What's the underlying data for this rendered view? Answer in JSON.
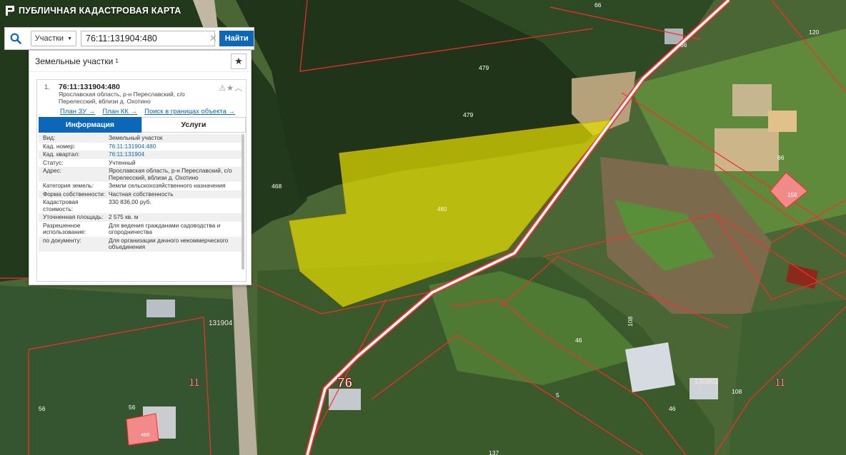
{
  "app": {
    "title": "ПУБЛИЧНАЯ КАДАСТРОВАЯ КАРТА"
  },
  "search": {
    "type_label": "Участки",
    "query": "76:11:131904:480",
    "find_label": "Найти"
  },
  "panel": {
    "title": "Земельные участки",
    "count": "1"
  },
  "result": {
    "number": "1.",
    "cad_number": "76:11:131904:480",
    "address": "Ярославская область, р-н Переславский, с/о Перелесский, вблизи д. Охотино",
    "links": [
      "План ЗУ →",
      "План КК →",
      "Поиск в границах объекта →"
    ]
  },
  "tabs": [
    "Информация",
    "Услуги"
  ],
  "attributes": [
    {
      "label": "Вид:",
      "value": "Земельный участок"
    },
    {
      "label": "Кад. номер:",
      "value": "76:11:131904:480"
    },
    {
      "label": "Кад. квартал:",
      "value": "76:11:131904"
    },
    {
      "label": "Статус:",
      "value": "Учтенный"
    },
    {
      "label": "Адрес:",
      "value": "Ярославская область, р-н Переславский, с/о Перелесский, вблизи д. Охотино"
    },
    {
      "label": "Категория земель:",
      "value": "Земли сельскохозяйственного назначения"
    },
    {
      "label": "Форма собственности:",
      "value": "Частная собственность"
    },
    {
      "label": "Кадастровая стоимость:",
      "value": "330 836,00 руб."
    },
    {
      "label": "Уточненная площадь:",
      "value": "2 575 кв. м"
    },
    {
      "label": "Разрешенное использование:",
      "value": "Для ведения гражданами садоводства и огородничества"
    },
    {
      "label": "по документу:",
      "value": "Для организации дачного некоммерческого объединения"
    }
  ],
  "map_labels": {
    "parcel_480": "480",
    "p479a": "479",
    "p479b": "479",
    "p468": "468",
    "p66a": "66",
    "p66b": "66",
    "p66c": "66",
    "p120": "120",
    "p159": "159",
    "p108a": "108",
    "p108b": "108",
    "p46a": "46",
    "p46b": "46",
    "p5": "5",
    "p56a": "56",
    "p56b": "56",
    "p466": "466",
    "p137": "137",
    "q131904": "131904",
    "q130801": "130801",
    "d11a": "11",
    "d11b": "11",
    "r76": "76"
  },
  "colors": {
    "accent": "#0d67b8",
    "parcel_fill": "#e5dc00",
    "boundary": "#ff2a2a"
  }
}
